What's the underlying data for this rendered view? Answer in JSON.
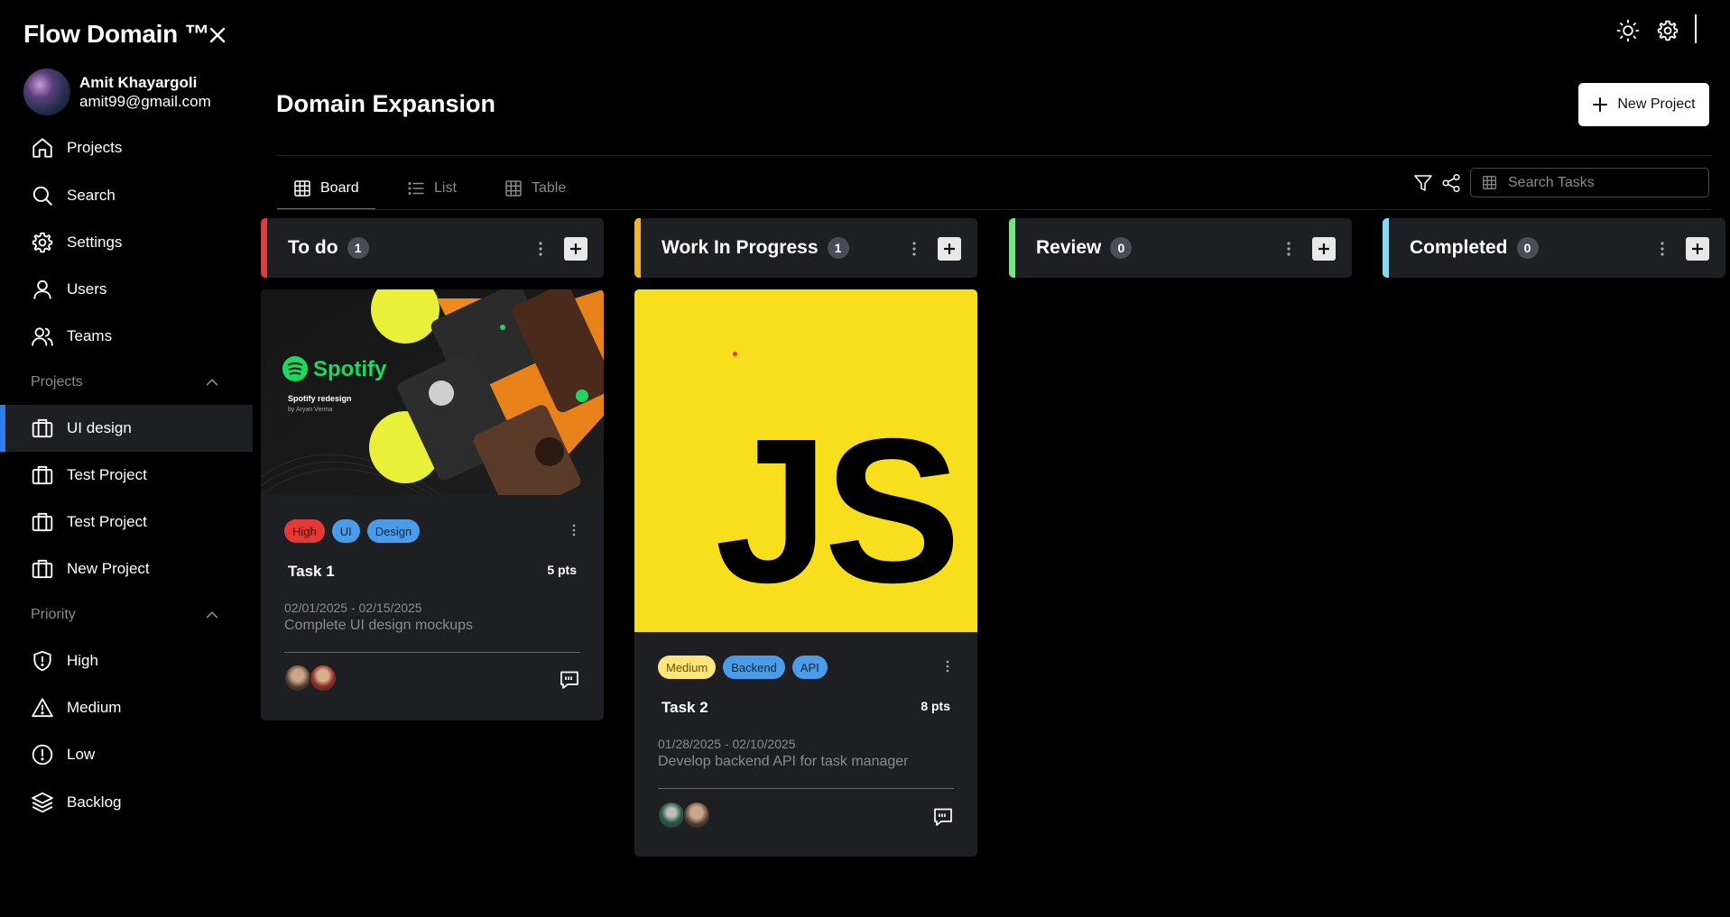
{
  "app": {
    "brand": "Flow Domain ™",
    "user": {
      "name": "Amit Khayargoli",
      "email": "amit99@gmail.com"
    }
  },
  "sidebar": {
    "nav": [
      {
        "label": "Projects",
        "icon": "home-icon"
      },
      {
        "label": "Search",
        "icon": "search-icon"
      },
      {
        "label": "Settings",
        "icon": "gear-icon"
      },
      {
        "label": "Users",
        "icon": "user-icon"
      },
      {
        "label": "Teams",
        "icon": "users-icon"
      }
    ],
    "projects_heading": "Projects",
    "projects": [
      {
        "label": "UI design",
        "icon": "briefcase-icon",
        "active": true
      },
      {
        "label": "Test Project",
        "icon": "briefcase-icon"
      },
      {
        "label": "Test Project",
        "icon": "briefcase-icon"
      },
      {
        "label": "New Project",
        "icon": "briefcase-icon"
      }
    ],
    "priority_heading": "Priority",
    "priority": [
      {
        "label": "High",
        "icon": "shield-alert-icon"
      },
      {
        "label": "Medium",
        "icon": "triangle-alert-icon"
      },
      {
        "label": "Low",
        "icon": "circle-alert-icon"
      },
      {
        "label": "Backlog",
        "icon": "layers-icon"
      }
    ],
    "accent_color": "#2f80ed"
  },
  "header": {
    "title": "Domain Expansion",
    "new_project_label": "New Project"
  },
  "tabs": [
    {
      "label": "Board",
      "icon": "grid-icon",
      "active": true
    },
    {
      "label": "List",
      "icon": "list-icon"
    },
    {
      "label": "Table",
      "icon": "table-icon"
    }
  ],
  "search": {
    "placeholder": "Search Tasks"
  },
  "columns": [
    {
      "title": "To do",
      "count": "1",
      "color": "#e53935"
    },
    {
      "title": "Work In Progress",
      "count": "1",
      "color": "#f5b524"
    },
    {
      "title": "Review",
      "count": "0",
      "color": "#7be383"
    },
    {
      "title": "Completed",
      "count": "0",
      "color": "#8ad8f0"
    }
  ],
  "cards": [
    {
      "image": "spotify-redesign-cover",
      "image_text": {
        "brand": "Spotify",
        "line1": "Spotify redesign",
        "line2": "by Aryan Verma"
      },
      "tags": [
        {
          "label": "High",
          "bg": "#e53935",
          "fg": "#1a1a1a"
        },
        {
          "label": "UI",
          "bg": "#4a9be8",
          "fg": "#0f2740"
        },
        {
          "label": "Design",
          "bg": "#4a9be8",
          "fg": "#0f2740"
        }
      ],
      "title": "Task 1",
      "points": "5 pts",
      "dates": "02/01/2025 - 02/15/2025",
      "description": "Complete UI design mockups"
    },
    {
      "image": "javascript-logo",
      "image_text": {
        "logo": "JS"
      },
      "tags": [
        {
          "label": "Medium",
          "bg": "#fde57a",
          "fg": "#6b5200"
        },
        {
          "label": "Backend",
          "bg": "#4a9be8",
          "fg": "#0f2740"
        },
        {
          "label": "API",
          "bg": "#4a9be8",
          "fg": "#0f2740"
        }
      ],
      "title": "Task 2",
      "points": "8 pts",
      "dates": "01/28/2025 - 02/10/2025",
      "description": "Develop backend API for task manager"
    }
  ]
}
